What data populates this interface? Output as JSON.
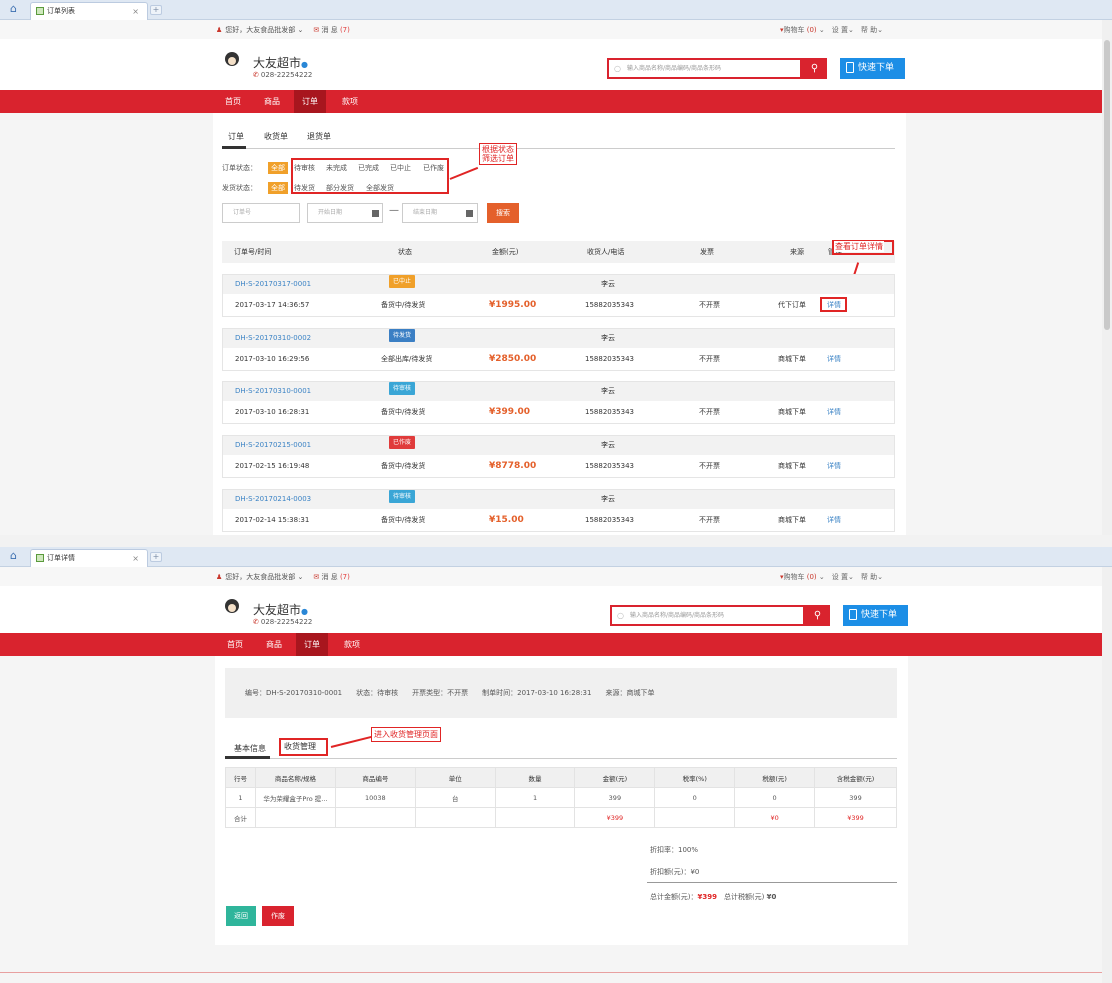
{
  "s1": {
    "tab_title": "订单列表",
    "topbar": {
      "greeting": "您好，大友食品批发部 ⌄",
      "messages": "消 息",
      "msg_count": "(7)",
      "cart": "购物车",
      "cart_count": "(0)",
      "settings": "设 置⌄",
      "help": "帮 助⌄"
    },
    "shop": {
      "name": "大友超市",
      "phone": "028-22254222"
    },
    "search_placeholder": "输入商品名称/商品编码/商品条形码",
    "quick_order": "快速下单",
    "nav": [
      "首页",
      "商品",
      "订单",
      "款项"
    ],
    "subtabs": [
      "订单",
      "收货单",
      "退货单"
    ],
    "order_status_label": "订单状态：",
    "order_status": [
      "全部",
      "待审核",
      "未完成",
      "已完成",
      "已中止",
      "已作废"
    ],
    "ship_status_label": "发货状态：",
    "ship_status": [
      "全部",
      "待发货",
      "部分发货",
      "全部发货"
    ],
    "annotation_filter": "根据状态\n筛选订单",
    "annotation_detail": "查看订单详情",
    "fields": {
      "order_no": "订单号",
      "start_date": "开始日期",
      "dash": "—",
      "end_date": "结束日期",
      "search": "搜索"
    },
    "columns": [
      "订单号/时间",
      "状态",
      "金额(元)",
      "收货人/电话",
      "发票",
      "来源",
      "管理"
    ],
    "orders": [
      {
        "no": "DH-S-20170317-0001",
        "badge": "已中止",
        "badge_color": "#f0a02a",
        "time": "2017-03-17 14:36:57",
        "ship": "备货中/待发货",
        "amount": "¥1995.00",
        "receiver": "李云",
        "tel": "15882035343",
        "invoice": "不开票",
        "source": "代下订单",
        "action": "详情"
      },
      {
        "no": "DH-S-20170310-0002",
        "badge": "待发货",
        "badge_color": "#3b7fc4",
        "time": "2017-03-10 16:29:56",
        "ship": "全部出库/待发货",
        "amount": "¥2850.00",
        "receiver": "李云",
        "tel": "15882035343",
        "invoice": "不开票",
        "source": "商城下单",
        "action": "详情"
      },
      {
        "no": "DH-S-20170310-0001",
        "badge": "待审核",
        "badge_color": "#3aa6d6",
        "time": "2017-03-10 16:28:31",
        "ship": "备货中/待发货",
        "amount": "¥399.00",
        "receiver": "李云",
        "tel": "15882035343",
        "invoice": "不开票",
        "source": "商城下单",
        "action": "详情"
      },
      {
        "no": "DH-S-20170215-0001",
        "badge": "已作废",
        "badge_color": "#e03b3b",
        "time": "2017-02-15 16:19:48",
        "ship": "备货中/待发货",
        "amount": "¥8778.00",
        "receiver": "李云",
        "tel": "15882035343",
        "invoice": "不开票",
        "source": "商城下单",
        "action": "详情"
      },
      {
        "no": "DH-S-20170214-0003",
        "badge": "待审核",
        "badge_color": "#3aa6d6",
        "time": "2017-02-14 15:38:31",
        "ship": "备货中/待发货",
        "amount": "¥15.00",
        "receiver": "李云",
        "tel": "15882035343",
        "invoice": "不开票",
        "source": "商城下单",
        "action": "详情"
      }
    ]
  },
  "s2": {
    "tab_title": "订单详情",
    "info": "编号：DH-S-20170310-0001　　状态：待审核　　开票类型：不开票　　制单时间：2017-03-10 16:28:31　　来源：商城下单",
    "tabs": [
      "基本信息",
      "收货管理"
    ],
    "annotation": "进入收货管理页面",
    "columns": [
      "行号",
      "商品名称/规格",
      "商品编号",
      "单位",
      "数量",
      "金额(元)",
      "税率(%)",
      "税额(元)",
      "含税金额(元)"
    ],
    "row": [
      "1",
      "华为荣耀盒子Pro 提...",
      "10038",
      "台",
      "1",
      "399",
      "0",
      "0",
      "399"
    ],
    "total_row": {
      "label": "合计",
      "amount": "¥399",
      "tax": "¥0",
      "taxed": "¥399"
    },
    "discount_rate": "折扣率：100%",
    "discount_amount": "折扣额(元)：¥0",
    "total_label": "总计金额(元)：",
    "total_value": "¥399",
    "total_tax_label": "总计税额(元)",
    "total_tax_value": "¥0",
    "buttons": [
      "返回",
      "作废"
    ]
  }
}
